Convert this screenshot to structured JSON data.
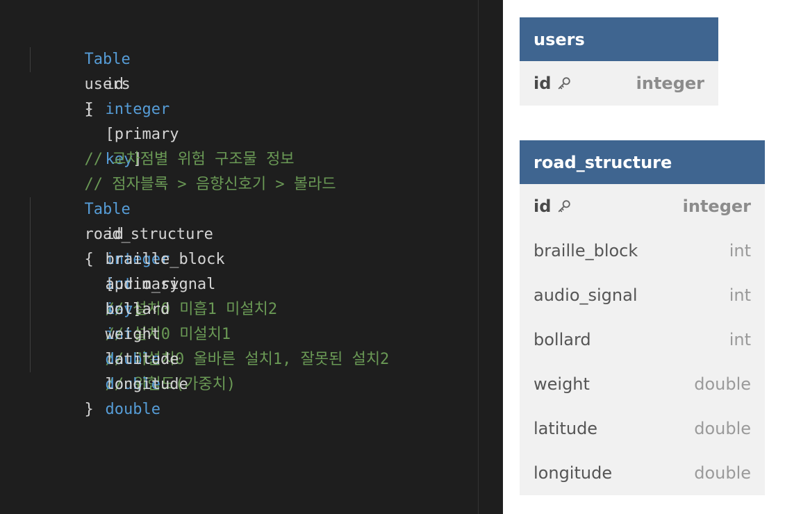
{
  "editor": {
    "users_table": {
      "open": [
        "Table",
        "users",
        "{"
      ],
      "rows": [
        {
          "name": "id",
          "type": "integer",
          "attr_open": "[primary",
          "attr_key": "key",
          "attr_close": "]"
        }
      ],
      "close": "}"
    },
    "comments": [
      "// 교차점별 위험 구조물 정보",
      "// 점자블록 > 음향신호기 > 볼라드"
    ],
    "road_table": {
      "open": [
        "Table",
        "road_structure",
        "{"
      ],
      "rows": [
        {
          "name": "id",
          "type": "integer",
          "attr_open": "[primary",
          "attr_key": "key",
          "attr_close": "]"
        },
        {
          "name": "braille_block",
          "type": "int",
          "comment": "// 설치0 미흡1 미설치2"
        },
        {
          "name": "audio_signal",
          "type": "int",
          "comment": "// 설치0 미설치1"
        },
        {
          "name": "bollard",
          "type": "int",
          "comment": "// 미설치0 올바른 설치1, 잘못된 설치2"
        },
        {
          "name": "weight",
          "type": "double",
          "comment": "// 위험도(가중치)"
        },
        {
          "name": "latitude",
          "type": "double"
        },
        {
          "name": "longitude",
          "type": "double"
        }
      ],
      "close": "}"
    }
  },
  "diagram": {
    "users": {
      "title": "users",
      "columns": [
        {
          "name": "id",
          "type": "integer",
          "primary": true
        }
      ]
    },
    "road_structure": {
      "title": "road_structure",
      "columns": [
        {
          "name": "id",
          "type": "integer",
          "primary": true
        },
        {
          "name": "braille_block",
          "type": "int"
        },
        {
          "name": "audio_signal",
          "type": "int"
        },
        {
          "name": "bollard",
          "type": "int"
        },
        {
          "name": "weight",
          "type": "double"
        },
        {
          "name": "latitude",
          "type": "double"
        },
        {
          "name": "longitude",
          "type": "double"
        }
      ]
    }
  },
  "colors": {
    "editor_bg": "#1e1e1e",
    "keyword": "#569cd6",
    "comment": "#6a9955",
    "identifier": "#d4d4d4",
    "table_header": "#3f6590",
    "table_body": "#f1f1f1"
  },
  "icons": [
    "key-icon"
  ]
}
